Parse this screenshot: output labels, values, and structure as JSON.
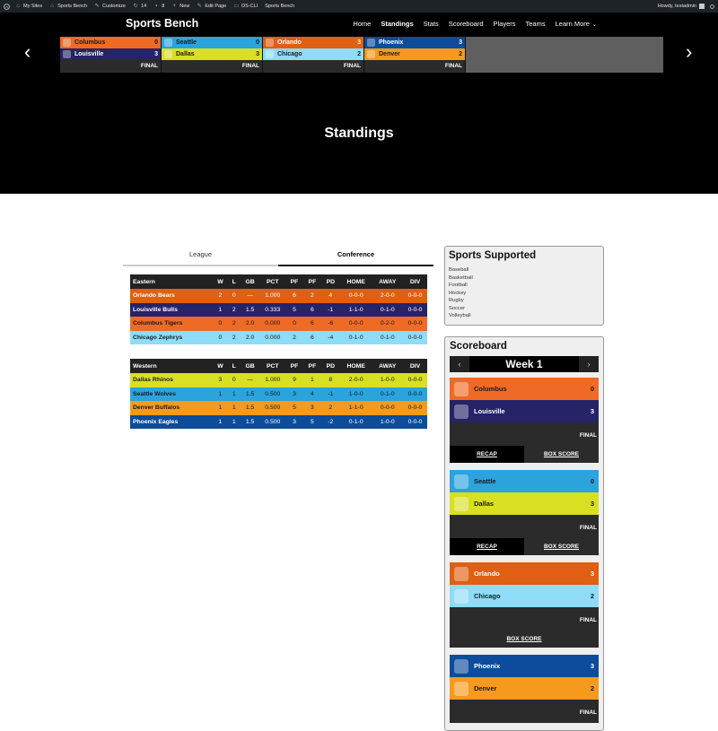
{
  "adminbar": {
    "items": [
      {
        "icon": "wordpress-icon",
        "label": ""
      },
      {
        "icon": "my-sites-icon",
        "label": "My Sites"
      },
      {
        "icon": "home-icon",
        "label": "Sports Bench"
      },
      {
        "icon": "brush-icon",
        "label": "Customize"
      },
      {
        "icon": "updates-icon",
        "label": "14"
      },
      {
        "icon": "comments-icon",
        "label": "8"
      },
      {
        "icon": "plus-icon",
        "label": "New"
      },
      {
        "icon": "pencil-icon",
        "label": "Edit Page"
      },
      {
        "icon": "terminal-icon",
        "label": "DS-CLI"
      },
      {
        "icon": "",
        "label": "Sports Bench"
      }
    ],
    "greeting": "Howdy, testadmin"
  },
  "header": {
    "site_title": "Sports Bench",
    "nav": [
      "Home",
      "Standings",
      "Stats",
      "Scoreboard",
      "Players",
      "Teams",
      "Learn More"
    ],
    "active_nav": "Standings"
  },
  "ticker": {
    "games": [
      {
        "away": {
          "name": "Columbus",
          "score": "0",
          "bg": "#ef6a25",
          "fg": "#1a1a1a"
        },
        "home": {
          "name": "Louisville",
          "score": "3",
          "bg": "#262368",
          "fg": "#ffffff"
        },
        "status": "FINAL"
      },
      {
        "away": {
          "name": "Seattle",
          "score": "0",
          "bg": "#2ba3dd",
          "fg": "#1a1a1a"
        },
        "home": {
          "name": "Dallas",
          "score": "3",
          "bg": "#d8e021",
          "fg": "#1a1a1a"
        },
        "status": "FINAL"
      },
      {
        "away": {
          "name": "Orlando",
          "score": "3",
          "bg": "#e05f12",
          "fg": "#ffffff"
        },
        "home": {
          "name": "Chicago",
          "score": "2",
          "bg": "#8edcf7",
          "fg": "#1a1a1a"
        },
        "status": "FINAL"
      },
      {
        "away": {
          "name": "Phoenix",
          "score": "3",
          "bg": "#0b4c9c",
          "fg": "#ffffff"
        },
        "home": {
          "name": "Denver",
          "score": "2",
          "bg": "#f59a1d",
          "fg": "#1a1a1a"
        },
        "status": "FINAL"
      }
    ]
  },
  "page_title": "Standings",
  "tabs": [
    {
      "label": "League",
      "active": false
    },
    {
      "label": "Conference",
      "active": true
    }
  ],
  "standings": {
    "columns": [
      "W",
      "L",
      "GB",
      "PCT",
      "PF",
      "PF",
      "PD",
      "HOME",
      "AWAY",
      "DIV"
    ],
    "conferences": [
      {
        "name": "Eastern",
        "rows": [
          {
            "team": "Orlando Bears",
            "values": [
              "2",
              "0",
              "—",
              "1.000",
              "6",
              "2",
              "4",
              "0-0-0",
              "2-0-0",
              "0-0-0"
            ],
            "bg": "#e05f12",
            "fg": "#ffffff"
          },
          {
            "team": "Louisville Bulls",
            "values": [
              "1",
              "2",
              "1.5",
              "0.333",
              "5",
              "6",
              "-1",
              "1-1-0",
              "0-1-0",
              "0-0-0"
            ],
            "bg": "#262368",
            "fg": "#ffffff"
          },
          {
            "team": "Columbus Tigers",
            "values": [
              "0",
              "2",
              "2.0",
              "0.000",
              "0",
              "6",
              "-6",
              "0-0-0",
              "0-2-0",
              "0-0-0"
            ],
            "bg": "#ef6a25",
            "fg": "#1a1a1a"
          },
          {
            "team": "Chicago Zephrys",
            "values": [
              "0",
              "2",
              "2.0",
              "0.000",
              "2",
              "6",
              "-4",
              "0-1-0",
              "0-1-0",
              "0-0-0"
            ],
            "bg": "#8edcf7",
            "fg": "#1a1a1a"
          }
        ]
      },
      {
        "name": "Western",
        "rows": [
          {
            "team": "Dallas Rhinos",
            "values": [
              "3",
              "0",
              "—",
              "1.000",
              "9",
              "1",
              "8",
              "2-0-0",
              "1-0-0",
              "0-0-0"
            ],
            "bg": "#d8e021",
            "fg": "#1a1a1a"
          },
          {
            "team": "Seattle Wolves",
            "values": [
              "1",
              "1",
              "1.5",
              "0.500",
              "3",
              "4",
              "-1",
              "1-0-0",
              "0-1-0",
              "0-0-0"
            ],
            "bg": "#2ba3dd",
            "fg": "#1a1a1a"
          },
          {
            "team": "Denver Buffalos",
            "values": [
              "1",
              "1",
              "1.5",
              "0.500",
              "5",
              "3",
              "2",
              "1-1-0",
              "0-0-0",
              "0-0-0"
            ],
            "bg": "#f59a1d",
            "fg": "#1a1a1a"
          },
          {
            "team": "Phoenix Eagles",
            "values": [
              "1",
              "1",
              "1.5",
              "0.500",
              "3",
              "5",
              "-2",
              "0-1-0",
              "1-0-0",
              "0-0-0"
            ],
            "bg": "#0b4c9c",
            "fg": "#ffffff"
          }
        ]
      }
    ]
  },
  "sidebar": {
    "sports_supported": {
      "title": "Sports Supported",
      "items": [
        "Baseball",
        "Basketball",
        "Football",
        "Hockey",
        "Rugby",
        "Soccer",
        "Volleyball"
      ]
    },
    "scoreboard": {
      "title": "Scoreboard",
      "week": "Week 1",
      "prev": "‹",
      "next": "›",
      "games": [
        {
          "away": {
            "name": "Columbus",
            "score": "0",
            "bg": "#ef6a25",
            "fg": "#1a1a1a"
          },
          "home": {
            "name": "Louisville",
            "score": "3",
            "bg": "#262368",
            "fg": "#ffffff"
          },
          "status": "FINAL",
          "links": [
            "RECAP",
            "BOX SCORE"
          ]
        },
        {
          "away": {
            "name": "Seattle",
            "score": "0",
            "bg": "#2ba3dd",
            "fg": "#1a1a1a"
          },
          "home": {
            "name": "Dallas",
            "score": "3",
            "bg": "#d8e021",
            "fg": "#1a1a1a"
          },
          "status": "FINAL",
          "links": [
            "RECAP",
            "BOX SCORE"
          ]
        },
        {
          "away": {
            "name": "Orlando",
            "score": "3",
            "bg": "#e05f12",
            "fg": "#ffffff"
          },
          "home": {
            "name": "Chicago",
            "score": "2",
            "bg": "#8edcf7",
            "fg": "#1a1a1a"
          },
          "status": "FINAL",
          "links": [
            "BOX SCORE"
          ]
        },
        {
          "away": {
            "name": "Phoenix",
            "score": "3",
            "bg": "#0b4c9c",
            "fg": "#ffffff"
          },
          "home": {
            "name": "Denver",
            "score": "2",
            "bg": "#f59a1d",
            "fg": "#1a1a1a"
          },
          "status": "FINAL",
          "links": []
        }
      ]
    }
  }
}
